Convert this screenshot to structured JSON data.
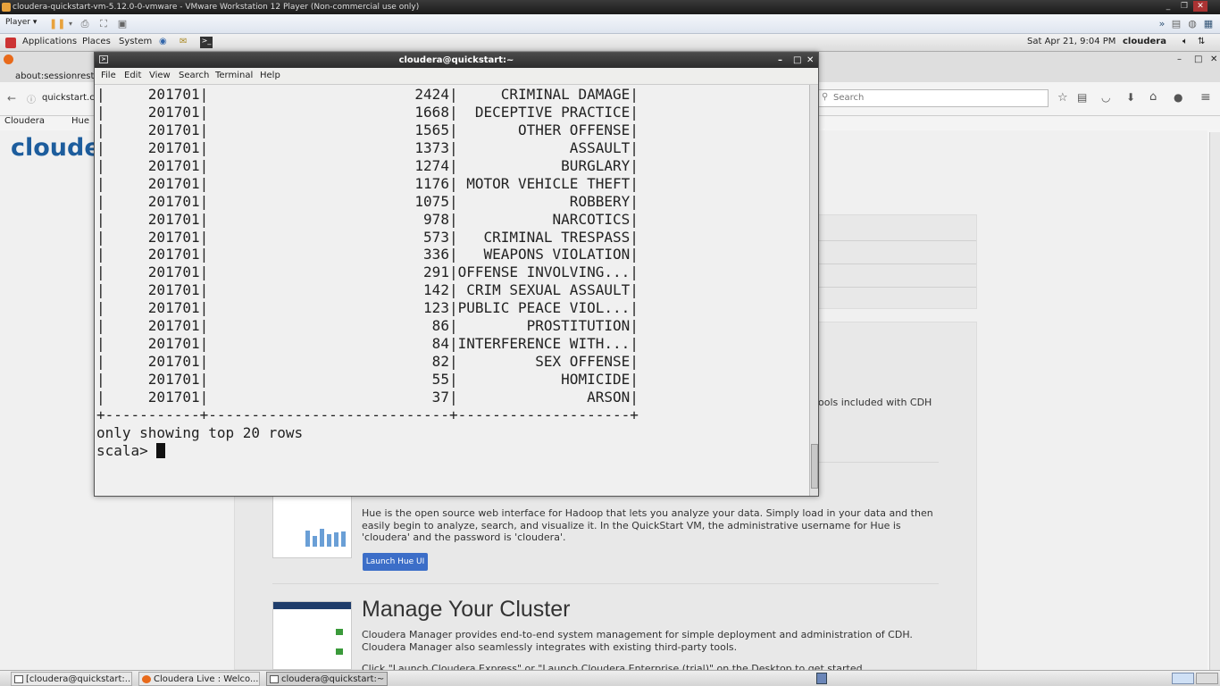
{
  "vm_window": {
    "title": "cloudera-quickstart-vm-5.12.0-0-vmware - VMware Workstation 12 Player (Non-commercial use only)",
    "player_label": "Player ▾"
  },
  "gnome_panel": {
    "menus": [
      "Applications",
      "Places",
      "System"
    ],
    "clock": "Sat Apr 21,  9:04 PM",
    "user": "cloudera"
  },
  "firefox": {
    "tab_title": "about:sessionresto",
    "url": "quickstart.cl",
    "search_placeholder": "Search",
    "bookmarks": [
      "Cloudera",
      "Hue"
    ],
    "logo_text": "cloude",
    "tools_text": "ools included with CDH",
    "hue_desc": "Hue is the open source web interface for Hadoop that lets you analyze your data. Simply load in your data and then easily begin to analyze, search, and visualize it. In the QuickStart VM, the administrative username for Hue is 'cloudera' and the password is 'cloudera'.",
    "hue_button": "Launch Hue UI",
    "manage_title": "Manage Your Cluster",
    "manage_desc": "Cloudera Manager provides end-to-end system management for simple deployment and administration of CDH. Cloudera Manager also seamlessly integrates with existing third-party tools.",
    "manage_more": "Click \"Launch Cloudera Express\" or \"Launch Cloudera Enterprise (trial)\" on the Desktop to get started."
  },
  "terminal": {
    "title": "cloudera@quickstart:~",
    "menu": [
      "File",
      "Edit",
      "View",
      "Search",
      "Terminal",
      "Help"
    ],
    "lines": [
      "|     201701|                        2424|     CRIMINAL DAMAGE|",
      "|     201701|                        1668|  DECEPTIVE PRACTICE|",
      "|     201701|                        1565|       OTHER OFFENSE|",
      "|     201701|                        1373|             ASSAULT|",
      "|     201701|                        1274|            BURGLARY|",
      "|     201701|                        1176| MOTOR VEHICLE THEFT|",
      "|     201701|                        1075|             ROBBERY|",
      "|     201701|                         978|           NARCOTICS|",
      "|     201701|                         573|   CRIMINAL TRESPASS|",
      "|     201701|                         336|   WEAPONS VIOLATION|",
      "|     201701|                         291|OFFENSE INVOLVING...|",
      "|     201701|                         142| CRIM SEXUAL ASSAULT|",
      "|     201701|                         123|PUBLIC PEACE VIOL...|",
      "|     201701|                          86|        PROSTITUTION|",
      "|     201701|                          84|INTERFERENCE WITH...|",
      "|     201701|                          82|         SEX OFFENSE|",
      "|     201701|                          55|            HOMICIDE|",
      "|     201701|                          37|               ARSON|",
      "+-----------+----------------------------+--------------------+",
      "only showing top 20 rows",
      "",
      ""
    ],
    "prompt": "scala> "
  },
  "taskbar": {
    "tasks": [
      "[cloudera@quickstart:...",
      "Cloudera Live : Welco...",
      "cloudera@quickstart:~"
    ]
  }
}
